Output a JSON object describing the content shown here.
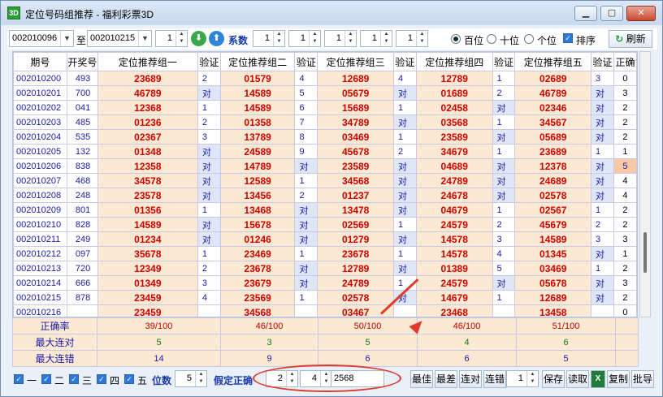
{
  "window": {
    "title": "定位号码组推荐 - 福利彩票3D",
    "app_icon": "3D",
    "icons": {
      "minimize": "minimize-icon",
      "maximize": "maximize-icon",
      "close": "close-icon"
    }
  },
  "toolbar": {
    "from_period": "002010096",
    "to_label": "至",
    "to_period": "002010215",
    "step_value": "1",
    "coefficient_label": "系数",
    "coefficients": [
      "1",
      "1",
      "1",
      "1",
      "1"
    ],
    "positions": [
      "百位",
      "十位",
      "个位"
    ],
    "selected_position": "百位",
    "sort_label": "排序",
    "sort_checked": true,
    "refresh_label": "刷新"
  },
  "table": {
    "headers": [
      "期号",
      "开奖号",
      "定位推荐组一",
      "验证",
      "定位推荐组二",
      "验证",
      "定位推荐组三",
      "验证",
      "定位推荐组四",
      "验证",
      "定位推荐组五",
      "验证",
      "正确"
    ],
    "rows": [
      [
        "002010200",
        "493",
        "23689",
        "2",
        "01579",
        "4",
        "12689",
        "4",
        "12789",
        "1",
        "02689",
        "3",
        "0"
      ],
      [
        "002010201",
        "700",
        "46789",
        "对",
        "14589",
        "5",
        "05679",
        "对",
        "01689",
        "2",
        "46789",
        "对",
        "3"
      ],
      [
        "002010202",
        "041",
        "12368",
        "1",
        "14589",
        "6",
        "15689",
        "1",
        "02458",
        "对",
        "02346",
        "对",
        "2"
      ],
      [
        "002010203",
        "485",
        "01236",
        "2",
        "01358",
        "7",
        "34789",
        "对",
        "03568",
        "1",
        "34567",
        "对",
        "2"
      ],
      [
        "002010204",
        "535",
        "02367",
        "3",
        "13789",
        "8",
        "03469",
        "1",
        "23589",
        "对",
        "05689",
        "对",
        "2"
      ],
      [
        "002010205",
        "132",
        "01348",
        "对",
        "24589",
        "9",
        "45678",
        "2",
        "34679",
        "1",
        "23689",
        "1",
        "1"
      ],
      [
        "002010206",
        "838",
        "12358",
        "对",
        "14789",
        "对",
        "23589",
        "对",
        "04689",
        "对",
        "12378",
        "对",
        "5"
      ],
      [
        "002010207",
        "468",
        "34578",
        "对",
        "12589",
        "1",
        "34568",
        "对",
        "24789",
        "对",
        "24689",
        "对",
        "4"
      ],
      [
        "002010208",
        "248",
        "23578",
        "对",
        "13456",
        "2",
        "01237",
        "对",
        "24678",
        "对",
        "02578",
        "对",
        "4"
      ],
      [
        "002010209",
        "801",
        "01356",
        "1",
        "13468",
        "对",
        "13478",
        "对",
        "04679",
        "1",
        "02567",
        "1",
        "2"
      ],
      [
        "002010210",
        "828",
        "14589",
        "对",
        "15678",
        "对",
        "02569",
        "1",
        "24579",
        "2",
        "45679",
        "2",
        "2"
      ],
      [
        "002010211",
        "249",
        "01234",
        "对",
        "01246",
        "对",
        "01279",
        "对",
        "14578",
        "3",
        "14589",
        "3",
        "3"
      ],
      [
        "002010212",
        "097",
        "35678",
        "1",
        "23469",
        "1",
        "23678",
        "1",
        "14578",
        "4",
        "01345",
        "对",
        "1"
      ],
      [
        "002010213",
        "720",
        "12349",
        "2",
        "23678",
        "对",
        "12789",
        "对",
        "01389",
        "5",
        "03469",
        "1",
        "2"
      ],
      [
        "002010214",
        "666",
        "01349",
        "3",
        "23679",
        "对",
        "24789",
        "1",
        "24579",
        "对",
        "05678",
        "对",
        "3"
      ],
      [
        "002010215",
        "878",
        "23459",
        "4",
        "23569",
        "1",
        "02578",
        "对",
        "14679",
        "1",
        "12689",
        "对",
        "2"
      ],
      [
        "002010216",
        "",
        "23459",
        "",
        "34568",
        "",
        "03467",
        "",
        "23468",
        "",
        "13458",
        "",
        "0"
      ]
    ]
  },
  "stats": {
    "labels": [
      "正确率",
      "最大连对",
      "最大连错"
    ],
    "accuracy": [
      "39/100",
      "46/100",
      "50/100",
      "46/100",
      "51/100"
    ],
    "max_streak_correct": [
      "5",
      "3",
      "5",
      "4",
      "6"
    ],
    "max_streak_wrong": [
      "14",
      "9",
      "6",
      "6",
      "5"
    ]
  },
  "bottom": {
    "groups": [
      "一",
      "二",
      "三",
      "四",
      "五"
    ],
    "digits_label": "位数",
    "digits_value": "5",
    "assume_label": "假定正确",
    "assume_values": [
      "2",
      "4"
    ],
    "assume_text": "2568",
    "buttons": [
      "最佳",
      "最差",
      "连对",
      "连错"
    ],
    "spin_value": "1",
    "save_label": "保存",
    "read_label": "读取",
    "copy_label": "复制",
    "batch_label": "批导"
  },
  "colors": {
    "recommend_bg": "#fbe9d3",
    "recommend_text": "#d10000",
    "dui_bg": "#dfe6f6",
    "highlight_correct": "#f8c9a4",
    "annotation": "#e03a2b"
  }
}
